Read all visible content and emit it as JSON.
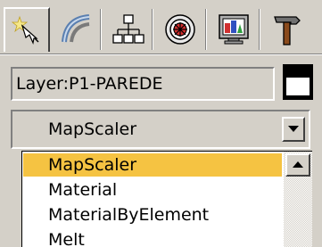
{
  "panel_tabs": [
    {
      "icon": "create-wand-icon",
      "active": true
    },
    {
      "icon": "modify-arc-icon",
      "active": false
    },
    {
      "icon": "hierarchy-icon",
      "active": false
    },
    {
      "icon": "motion-icon",
      "active": false
    },
    {
      "icon": "display-monitor-icon",
      "active": false
    },
    {
      "icon": "utilities-hammer-icon",
      "active": false
    }
  ],
  "object_name": {
    "value": "Layer:P1-PAREDE"
  },
  "object_color": {
    "outer": "#000000",
    "inner": "#ffffff"
  },
  "modifier_list": {
    "selected_value": "MapScaler",
    "items": [
      "MapScaler",
      "Material",
      "MaterialByElement",
      "Melt"
    ],
    "highlight_color": "#f5c342"
  }
}
